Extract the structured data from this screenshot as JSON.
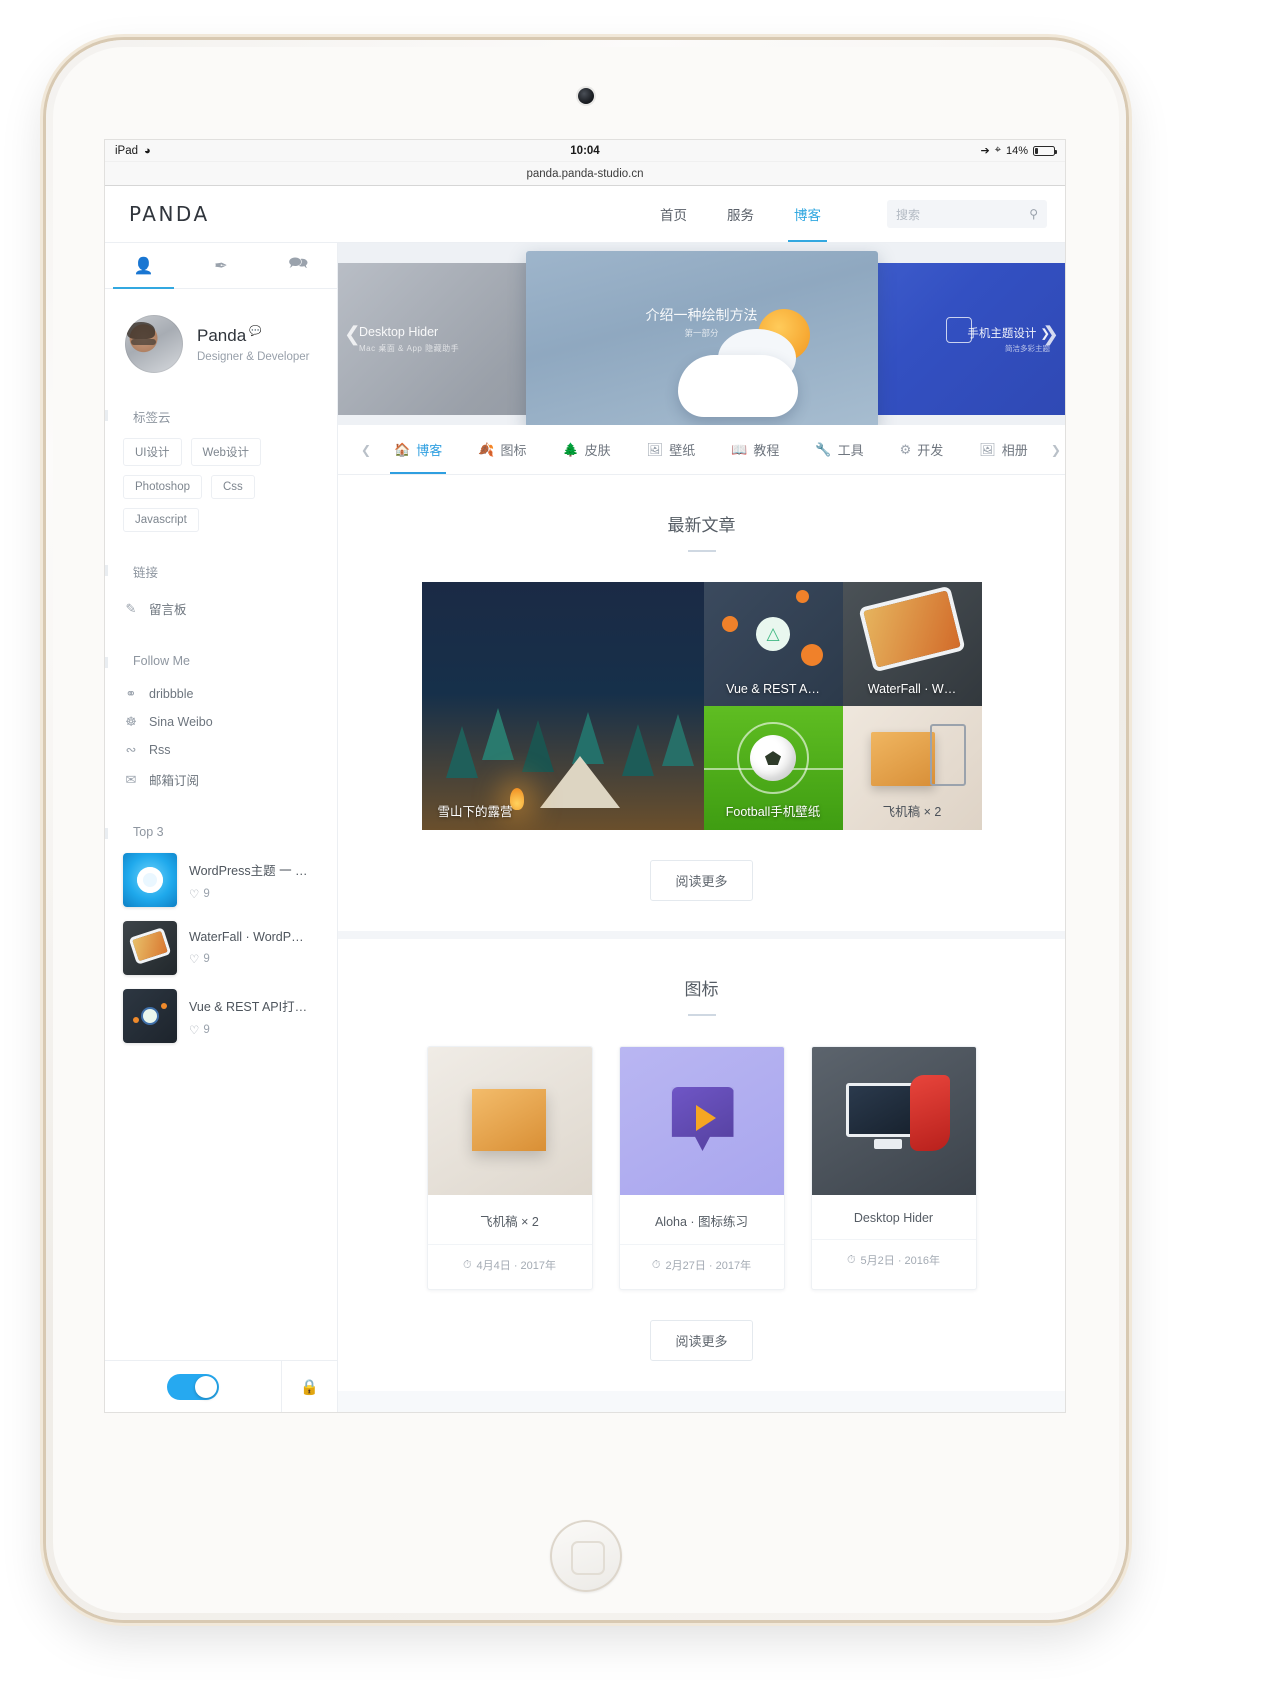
{
  "status_bar": {
    "device": "iPad",
    "wifi_icon": "wifi-icon",
    "time": "10:04",
    "location_icon": "location-arrow-icon",
    "bluetooth_icon": "bluetooth-icon",
    "battery_percent": "14%"
  },
  "browser": {
    "url": "panda.panda-studio.cn"
  },
  "header": {
    "logo": "PANDA",
    "nav": [
      {
        "label": "首页",
        "active": false
      },
      {
        "label": "服务",
        "active": false
      },
      {
        "label": "博客",
        "active": true
      }
    ],
    "search": {
      "placeholder": "搜索",
      "value": "",
      "icon": "search-icon"
    },
    "accent_color": "#32a8e0"
  },
  "sidebar": {
    "tabs": [
      {
        "icon": "user-icon",
        "active": true
      },
      {
        "icon": "feather-pen-icon",
        "active": false
      },
      {
        "icon": "comments-icon",
        "active": false
      }
    ],
    "profile": {
      "name": "Panda",
      "badge_icon": "quote-badge",
      "role": "Designer & Developer"
    },
    "tag_cloud": {
      "title": "标签云",
      "tags": [
        "UI设计",
        "Web设计",
        "Photoshop",
        "Css",
        "Javascript"
      ]
    },
    "links": {
      "title": "链接",
      "items": [
        {
          "icon": "edit-icon",
          "label": "留言板"
        }
      ]
    },
    "follow": {
      "title": "Follow Me",
      "items": [
        {
          "icon": "dribbble-icon",
          "label": "dribbble"
        },
        {
          "icon": "weibo-icon",
          "label": "Sina Weibo"
        },
        {
          "icon": "rss-icon",
          "label": "Rss"
        },
        {
          "icon": "mail-icon",
          "label": "邮箱订阅"
        }
      ]
    },
    "top3": {
      "title": "Top 3",
      "items": [
        {
          "title": "WordPress主题 一 …",
          "likes": "9",
          "thumb": "wordpress-theme-thumb"
        },
        {
          "title": "WaterFall · WordP…",
          "likes": "9",
          "thumb": "waterfall-thumb"
        },
        {
          "title": "Vue & REST API打…",
          "likes": "9",
          "thumb": "vue-rest-thumb"
        }
      ],
      "like_icon": "heart-icon"
    },
    "footer": {
      "toggle_on": true,
      "lock_icon": "lock-icon"
    }
  },
  "hero": {
    "prev_icon": "chevron-left-icon",
    "next_icon": "chevron-right-icon",
    "slides": [
      {
        "title": "Desktop Hider",
        "subtitle": "Mac 桌面 & App 隐藏助手",
        "position": "left"
      },
      {
        "title": "介绍一种绘制方法",
        "subtitle": "第一部分",
        "position": "center"
      },
      {
        "title": "手机主题设计",
        "subtitle": "简洁多彩主题",
        "position": "right"
      }
    ]
  },
  "category_tabs": {
    "prev_icon": "chevron-left-icon",
    "next_icon": "chevron-right-icon",
    "items": [
      {
        "label": "博客",
        "icon": "home-icon",
        "active": true
      },
      {
        "label": "图标",
        "icon": "leaf-icon",
        "active": false
      },
      {
        "label": "皮肤",
        "icon": "tree-icon",
        "active": false
      },
      {
        "label": "壁纸",
        "icon": "image-icon",
        "active": false
      },
      {
        "label": "教程",
        "icon": "book-icon",
        "active": false
      },
      {
        "label": "工具",
        "icon": "wrench-icon",
        "active": false
      },
      {
        "label": "开发",
        "icon": "gears-icon",
        "active": false
      },
      {
        "label": "相册",
        "icon": "photo-icon",
        "active": false
      }
    ]
  },
  "sections": [
    {
      "title": "最新文章",
      "read_more": "阅读更多",
      "tiles": [
        {
          "caption": "雪山下的露营",
          "art": "camping"
        },
        {
          "caption": "Vue & REST A…",
          "art": "vue"
        },
        {
          "caption": "WaterFall · W…",
          "art": "waterfall"
        },
        {
          "caption": "Football手机壁纸",
          "art": "football"
        },
        {
          "caption": "飞机稿 × 2",
          "art": "box"
        }
      ]
    },
    {
      "title": "图标",
      "read_more": "阅读更多",
      "cards": [
        {
          "title": "飞机稿 × 2",
          "date": "4月4日 · 2017年",
          "art": "box",
          "date_icon": "clock-icon"
        },
        {
          "title": "Aloha · 图标练习",
          "date": "2月27日 · 2017年",
          "art": "aloha",
          "date_icon": "clock-icon"
        },
        {
          "title": "Desktop Hider",
          "date": "5月2日 · 2016年",
          "art": "hider",
          "date_icon": "clock-icon"
        }
      ]
    }
  ]
}
